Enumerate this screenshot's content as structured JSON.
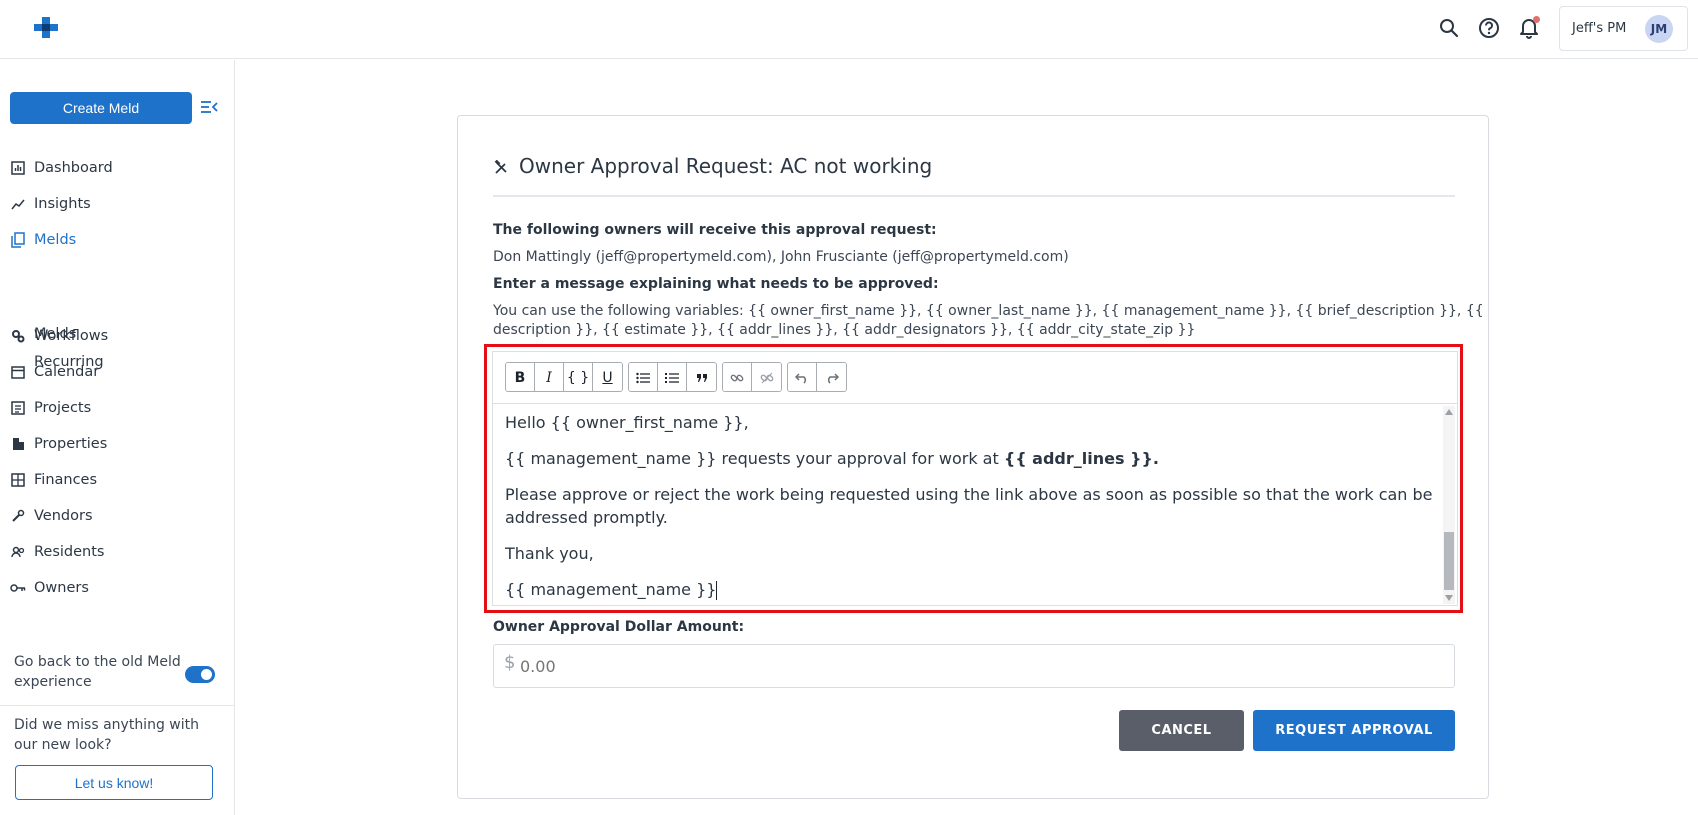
{
  "header": {
    "account_name": "Jeff's PM",
    "avatar_initials": "JM",
    "icons": [
      "search-icon",
      "help-icon",
      "bell-icon"
    ]
  },
  "sidebar": {
    "create_label": "Create Meld",
    "items": [
      {
        "label": "Dashboard",
        "icon": "dashboard-icon"
      },
      {
        "label": "Insights",
        "icon": "insights-icon"
      },
      {
        "label": "Melds",
        "icon": "melds-icon",
        "active": true
      },
      {
        "label": "Workflows",
        "icon": "workflows-icon"
      },
      {
        "label": "Calendar",
        "icon": "calendar-icon"
      },
      {
        "label": "Projects",
        "icon": "projects-icon"
      },
      {
        "label": "Properties",
        "icon": "properties-icon"
      },
      {
        "label": "Finances",
        "icon": "finances-icon"
      },
      {
        "label": "Vendors",
        "icon": "vendors-icon"
      },
      {
        "label": "Residents",
        "icon": "residents-icon"
      },
      {
        "label": "Owners",
        "icon": "owners-icon"
      }
    ],
    "sub_items": [
      {
        "label": "Melds"
      },
      {
        "label": "Recurring"
      }
    ],
    "old_experience": "Go back to the old Meld experience",
    "miss_text": "Did we miss anything with our new look?",
    "letus_label": "Let us know!"
  },
  "card": {
    "title": "Owner Approval Request: AC not working",
    "owners_label": "The following owners will receive this approval request:",
    "owners_text": "Don Mattingly (jeff@propertymeld.com), John Frusciante (jeff@propertymeld.com)",
    "message_label": "Enter a message explaining what needs to be approved:",
    "variables_line1": "You can use the following variables: {{ owner_first_name }}, {{ owner_last_name }}, {{ management_name }}, {{ brief_description }}, {{",
    "variables_line2": "description }}, {{ estimate }}, {{ addr_lines }}, {{ addr_designators }}, {{ addr_city_state_zip }}",
    "editor": {
      "line1": "Hello {{ owner_first_name }},",
      "line2_pre": "{{ management_name }} requests your approval for work at ",
      "line2_bold": "{{ addr_lines }}.",
      "line3": "Please approve or reject the work being requested using the link above as soon as possible so that the work can be addressed promptly.",
      "line4": "Thank you,",
      "line5": "{{ management_name }}"
    },
    "toolbar": {
      "bold": "B",
      "italic": "I",
      "code": "{ }",
      "underline": "U"
    },
    "dollar_label": "Owner Approval Dollar Amount:",
    "dollar_sign": "$",
    "dollar_placeholder": "0.00",
    "cancel_label": "CANCEL",
    "request_label": "REQUEST APPROVAL"
  },
  "colors": {
    "primary": "#1f72c9",
    "highlight_border": "#e30f14",
    "cancel": "#5a5e68"
  }
}
